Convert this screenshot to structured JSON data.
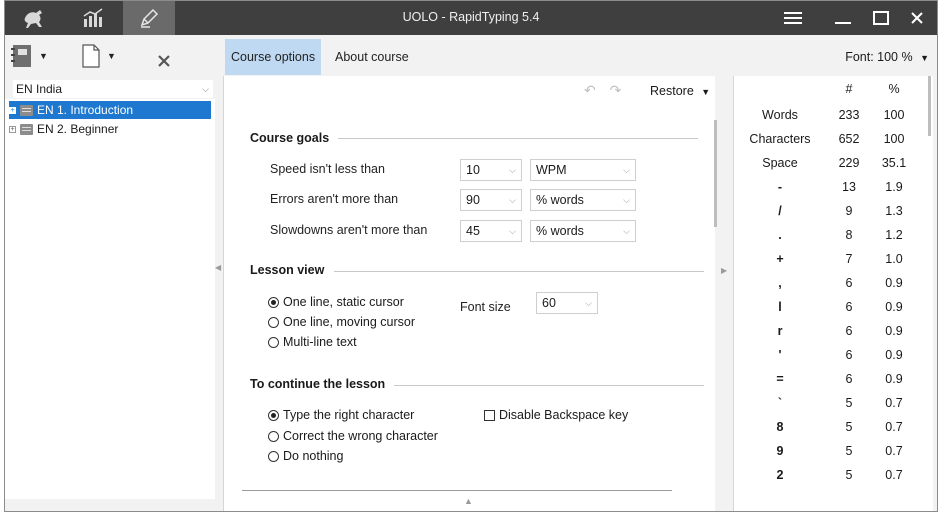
{
  "window": {
    "title": "UOLO - RapidTyping 5.4"
  },
  "toolbar": {
    "tabs": [
      {
        "icon": "kangaroo-icon",
        "active": false
      },
      {
        "icon": "statistics-chart-icon",
        "active": false
      },
      {
        "icon": "pencil-editor-icon",
        "active": true
      }
    ],
    "window_controls": [
      "menu-icon",
      "minimize-icon",
      "maximize-icon",
      "close-icon"
    ]
  },
  "left_panel": {
    "course_selected": "EN India",
    "lessons": [
      {
        "label": "EN 1. Introduction",
        "selected": true
      },
      {
        "label": "EN 2. Beginner",
        "selected": false
      }
    ]
  },
  "tabs": {
    "course_options": "Course options",
    "about_course": "About course",
    "font": "Font: 100 %"
  },
  "options": {
    "restore": "Restore",
    "course_goals": {
      "title": "Course goals",
      "rows": [
        {
          "label": "Speed isn't less than",
          "value": "10",
          "unit": "WPM"
        },
        {
          "label": "Errors aren't more than",
          "value": "90",
          "unit": "% words"
        },
        {
          "label": "Slowdowns aren't more than",
          "value": "45",
          "unit": "% words"
        }
      ]
    },
    "lesson_view": {
      "title": "Lesson view",
      "options": [
        {
          "label": "One line, static cursor",
          "checked": true
        },
        {
          "label": "One line, moving cursor",
          "checked": false
        },
        {
          "label": "Multi-line text",
          "checked": false
        }
      ],
      "font_size_label": "Font size",
      "font_size_value": "60"
    },
    "continue_lesson": {
      "title": "To continue the lesson",
      "options": [
        {
          "label": "Type the right character",
          "checked": true
        },
        {
          "label": "Correct the wrong character",
          "checked": false
        },
        {
          "label": "Do nothing",
          "checked": false
        }
      ],
      "disable_backspace": "Disable Backspace key"
    }
  },
  "stats": {
    "headers": [
      "",
      "#",
      "%"
    ],
    "rows": [
      {
        "item": "Words",
        "count": "233",
        "pct": "100",
        "symbol": false
      },
      {
        "item": "Characters",
        "count": "652",
        "pct": "100",
        "symbol": false
      },
      {
        "item": "Space",
        "count": "229",
        "pct": "35.1",
        "symbol": false
      },
      {
        "item": "-",
        "count": "13",
        "pct": "1.9",
        "symbol": true
      },
      {
        "item": "/",
        "count": "9",
        "pct": "1.3",
        "symbol": true
      },
      {
        "item": ".",
        "count": "8",
        "pct": "1.2",
        "symbol": true
      },
      {
        "item": "+",
        "count": "7",
        "pct": "1.0",
        "symbol": true
      },
      {
        "item": ",",
        "count": "6",
        "pct": "0.9",
        "symbol": true
      },
      {
        "item": "l",
        "count": "6",
        "pct": "0.9",
        "symbol": true
      },
      {
        "item": "r",
        "count": "6",
        "pct": "0.9",
        "symbol": true
      },
      {
        "item": "'",
        "count": "6",
        "pct": "0.9",
        "symbol": true
      },
      {
        "item": "=",
        "count": "6",
        "pct": "0.9",
        "symbol": true
      },
      {
        "item": "`",
        "count": "5",
        "pct": "0.7",
        "symbol": true
      },
      {
        "item": "8",
        "count": "5",
        "pct": "0.7",
        "symbol": true
      },
      {
        "item": "9",
        "count": "5",
        "pct": "0.7",
        "symbol": true
      },
      {
        "item": "2",
        "count": "5",
        "pct": "0.7",
        "symbol": true
      }
    ]
  },
  "colors": {
    "titlebar": "#3f3f3f",
    "active_tab": "#bfd9f2",
    "tree_selection": "#1e78d0"
  }
}
